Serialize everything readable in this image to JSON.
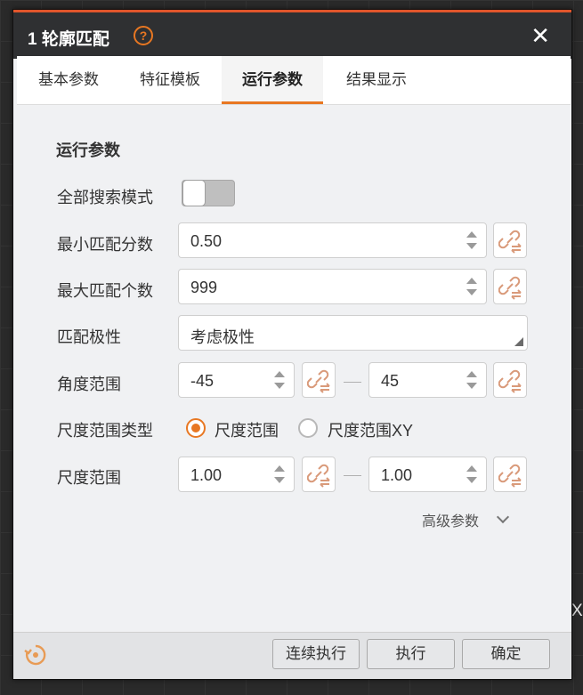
{
  "dialog": {
    "title": "1 轮廓匹配",
    "help_symbol": "?",
    "close_symbol": "✕"
  },
  "tabs": [
    {
      "label": "基本参数",
      "active": false
    },
    {
      "label": "特征模板",
      "active": false
    },
    {
      "label": "运行参数",
      "active": true
    },
    {
      "label": "结果显示",
      "active": false
    }
  ],
  "section": {
    "title": "运行参数"
  },
  "fields": {
    "search_mode": {
      "label": "全部搜索模式",
      "enabled": false
    },
    "min_score": {
      "label": "最小匹配分数",
      "value": "0.50"
    },
    "max_count": {
      "label": "最大匹配个数",
      "value": "999"
    },
    "polarity": {
      "label": "匹配极性",
      "value": "考虑极性"
    },
    "angle": {
      "label": "角度范围",
      "min": "-45",
      "max": "45"
    },
    "scale_type": {
      "label": "尺度范围类型",
      "options": [
        "尺度范围",
        "尺度范围XY"
      ],
      "selected": "尺度范围"
    },
    "scale": {
      "label": "尺度范围",
      "min": "1.00",
      "max": "1.00"
    }
  },
  "advanced": {
    "label": "高级参数"
  },
  "footer": {
    "continuous_label": "连续执行",
    "run_label": "执行",
    "ok_label": "确定"
  },
  "background": {
    "stray_text": "X"
  },
  "colors": {
    "accent": "#e87722",
    "titlebar": "#2f3032",
    "panel": "#f0f1f3"
  }
}
